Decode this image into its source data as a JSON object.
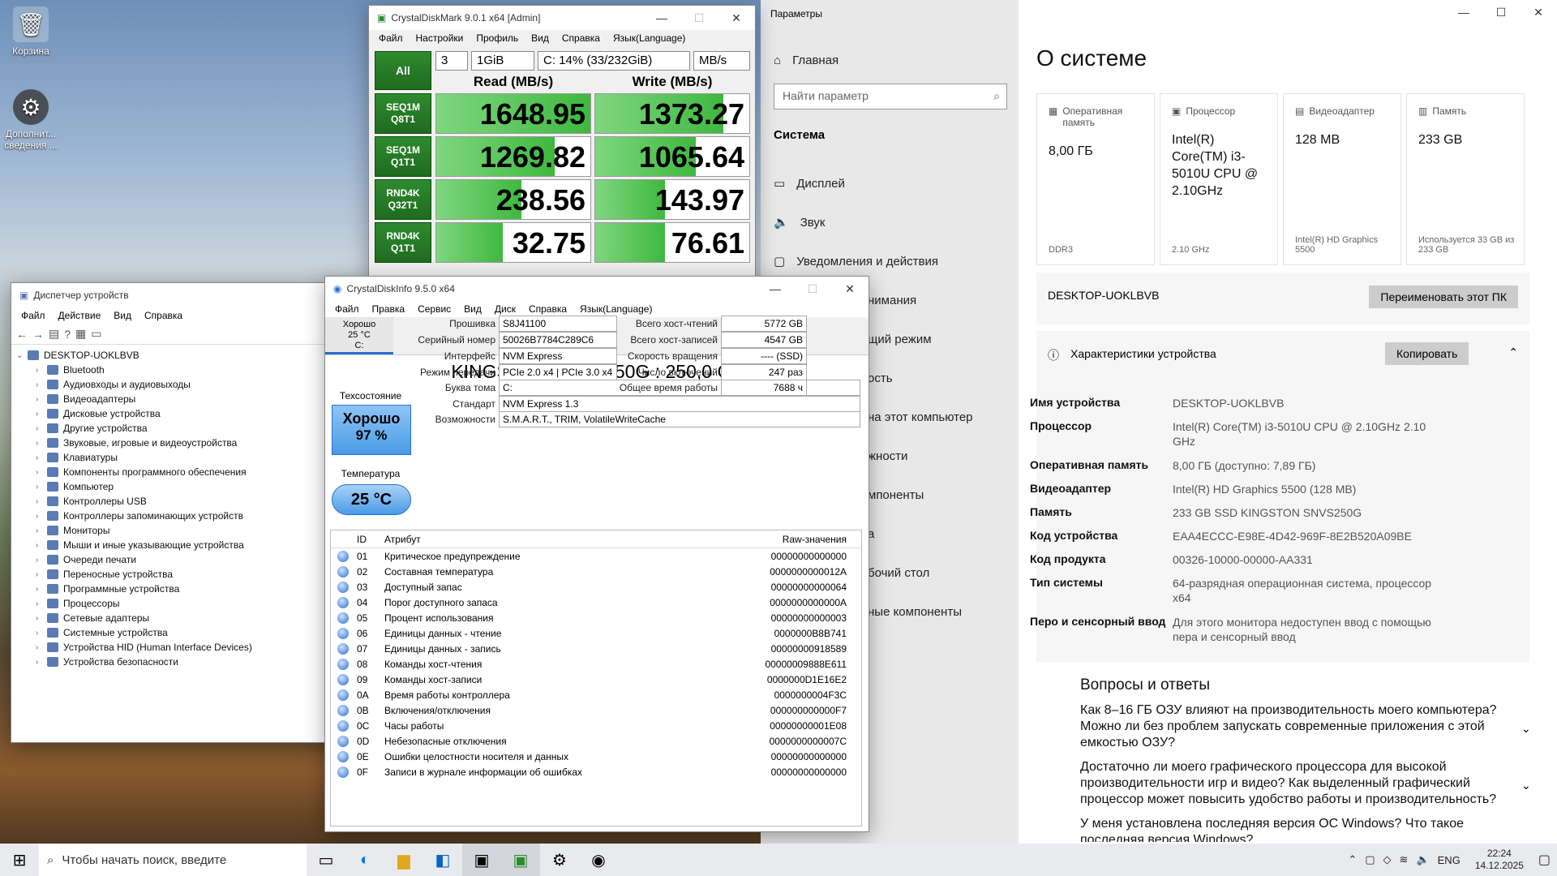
{
  "desktop": {
    "icons": [
      {
        "label": "Корзина"
      },
      {
        "label": "Дополнит... сведения ..."
      }
    ]
  },
  "settings": {
    "window_title": "Параметры",
    "home": "Главная",
    "search_placeholder": "Найти параметр",
    "section": "Система",
    "nav": [
      {
        "label": "Дисплей"
      },
      {
        "label": "Звук"
      },
      {
        "label": "Уведомления и действия"
      },
      {
        "label": "нимания"
      },
      {
        "label": "щий режим"
      },
      {
        "label": "ость"
      },
      {
        "label": "на этот компьютер"
      },
      {
        "label": "жности"
      },
      {
        "label": "мпоненты"
      },
      {
        "label": "а"
      },
      {
        "label": "бочий стол"
      },
      {
        "label": "ные компоненты"
      }
    ],
    "page_title": "О системе",
    "cards": [
      {
        "caption": "Оперативная память",
        "value": "8,00 ГБ",
        "sub": "DDR3"
      },
      {
        "caption": "Процессор",
        "value": "Intel(R) Core(TM) i3-5010U CPU @ 2.10GHz",
        "sub": "2.10 GHz"
      },
      {
        "caption": "Видеоадаптер",
        "value": "128 MB",
        "sub": "Intel(R) HD Graphics 5500"
      },
      {
        "caption": "Память",
        "value": "233 GB",
        "sub": "Используется 33 GB из 233 GB"
      }
    ],
    "pc_name": "DESKTOP-UOKLBVB",
    "rename_button": "Переименовать этот ПК",
    "device_specs_title": "Характеристики устройства",
    "copy_button": "Копировать",
    "specs": [
      {
        "k": "Имя устройства",
        "v": "DESKTOP-UOKLBVB"
      },
      {
        "k": "Процессор",
        "v": "Intel(R) Core(TM) i3-5010U CPU @ 2.10GHz   2.10 GHz"
      },
      {
        "k": "Оперативная память",
        "v": "8,00 ГБ (доступно: 7,89 ГБ)"
      },
      {
        "k": "Видеоадаптер",
        "v": "Intel(R) HD Graphics 5500 (128 MB)"
      },
      {
        "k": "Память",
        "v": "233 GB SSD KINGSTON SNVS250G"
      },
      {
        "k": "Код устройства",
        "v": "EAA4ECCC-E98E-4D42-969F-8E2B520A09BE"
      },
      {
        "k": "Код продукта",
        "v": "00326-10000-00000-AA331"
      },
      {
        "k": "Тип системы",
        "v": "64-разрядная операционная система, процессор x64"
      },
      {
        "k": "Перо и сенсорный ввод",
        "v": "Для этого монитора недоступен ввод с помощью пера и сенсорный ввод"
      }
    ],
    "qa_title": "Вопросы и ответы",
    "qa": [
      {
        "q": "Как 8–16 ГБ ОЗУ влияют на производительность моего компьютера? Можно ли без проблем запускать современные приложения с этой емкостью ОЗУ?"
      },
      {
        "q": "Достаточно ли моего графического процессора для высокой производительности игр и видео? Как выделенный графический процессор может повысить удобство работы и производительность?"
      },
      {
        "q": "У меня установлена последняя версия ОС Windows? Что такое последняя версия Windows?"
      }
    ]
  },
  "cdm": {
    "title": "CrystalDiskMark 9.0.1 x64 [Admin]",
    "menu": [
      "Файл",
      "Настройки",
      "Профиль",
      "Вид",
      "Справка",
      "Язык(Language)"
    ],
    "all_button": "All",
    "count": "3",
    "size": "1GiB",
    "drive": "C: 14% (33/232GiB)",
    "unit": "MB/s",
    "read_header": "Read (MB/s)",
    "write_header": "Write (MB/s)",
    "rows": [
      {
        "l1": "SEQ1M",
        "l2": "Q8T1",
        "read": "1648.95",
        "write": "1373.27",
        "rfill": 1.0,
        "wfill": 0.83
      },
      {
        "l1": "SEQ1M",
        "l2": "Q1T1",
        "read": "1269.82",
        "write": "1065.64",
        "rfill": 0.77,
        "wfill": 0.65
      },
      {
        "l1": "RND4K",
        "l2": "Q32T1",
        "read": "238.56",
        "write": "143.97",
        "rfill": 0.55,
        "wfill": 0.45
      },
      {
        "l1": "RND4K",
        "l2": "Q1T1",
        "read": "32.75",
        "write": "76.61",
        "rfill": 0.43,
        "wfill": 0.45
      }
    ]
  },
  "devmgr": {
    "title": "Диспетчер устройств",
    "menu": [
      "Файл",
      "Действие",
      "Вид",
      "Справка"
    ],
    "root": "DESKTOP-UOKLBVB",
    "items": [
      "Bluetooth",
      "Аудиовходы и аудиовыходы",
      "Видеоадаптеры",
      "Дисковые устройства",
      "Другие устройства",
      "Звуковые, игровые и видеоустройства",
      "Клавиатуры",
      "Компоненты программного обеспечения",
      "Компьютер",
      "Контроллеры USB",
      "Контроллеры запоминающих устройств",
      "Мониторы",
      "Мыши и иные указывающие устройства",
      "Очереди печати",
      "Переносные устройства",
      "Программные устройства",
      "Процессоры",
      "Сетевые адаптеры",
      "Системные устройства",
      "Устройства HID (Human Interface Devices)",
      "Устройства безопасности"
    ]
  },
  "cdi": {
    "title": "CrystalDiskInfo 9.5.0 x64",
    "menu": [
      "Файл",
      "Правка",
      "Сервис",
      "Вид",
      "Диск",
      "Справка",
      "Язык(Language)"
    ],
    "tab_status": "Хорошо",
    "tab_temp": "25 °C",
    "tab_drive": "C:",
    "model": "KINGSTON SNVS250G : 250,0 GB",
    "health_label": "Техсостояние",
    "health_text": "Хорошо",
    "health_pct": "97 %",
    "temp_label": "Температура",
    "temp_value": "25 °C",
    "left_fields": [
      {
        "k": "Прошивка",
        "v": "S8J41100"
      },
      {
        "k": "Серийный номер",
        "v": "50026B7784C289C6"
      },
      {
        "k": "Интерфейс",
        "v": "NVM Express"
      },
      {
        "k": "Режим передачи",
        "v": "PCIe 2.0 x4 | PCIe 3.0 x4"
      },
      {
        "k": "Буква тома",
        "v": "C:"
      },
      {
        "k": "Стандарт",
        "v": "NVM Express 1.3"
      },
      {
        "k": "Возможности",
        "v": "S.M.A.R.T., TRIM, VolatileWriteCache"
      }
    ],
    "right_fields": [
      {
        "k": "Всего хост-чтений",
        "v": "5772 GB"
      },
      {
        "k": "Всего хост-записей",
        "v": "4547 GB"
      },
      {
        "k": "Скорость вращения",
        "v": "---- (SSD)"
      },
      {
        "k": "Число включений",
        "v": "247 раз"
      },
      {
        "k": "Общее время работы",
        "v": "7688 ч"
      }
    ],
    "table_headers": {
      "id": "ID",
      "name": "Атрибут",
      "raw": "Raw-значения"
    },
    "attributes": [
      {
        "id": "01",
        "name": "Критическое предупреждение",
        "raw": "00000000000000"
      },
      {
        "id": "02",
        "name": "Составная температура",
        "raw": "0000000000012A"
      },
      {
        "id": "03",
        "name": "Доступный запас",
        "raw": "00000000000064"
      },
      {
        "id": "04",
        "name": "Порог доступного запаса",
        "raw": "0000000000000A"
      },
      {
        "id": "05",
        "name": "Процент использования",
        "raw": "00000000000003"
      },
      {
        "id": "06",
        "name": "Единицы данных - чтение",
        "raw": "0000000B8B741"
      },
      {
        "id": "07",
        "name": "Единицы данных - запись",
        "raw": "00000000918589"
      },
      {
        "id": "08",
        "name": "Команды хост-чтения",
        "raw": "00000009888E611"
      },
      {
        "id": "09",
        "name": "Команды хост-записи",
        "raw": "0000000D1E16E2"
      },
      {
        "id": "0A",
        "name": "Время работы контроллера",
        "raw": "0000000004F3C"
      },
      {
        "id": "0B",
        "name": "Включения/отключения",
        "raw": "000000000000F7"
      },
      {
        "id": "0C",
        "name": "Часы работы",
        "raw": "00000000001E08"
      },
      {
        "id": "0D",
        "name": "Небезопасные отключения",
        "raw": "0000000000007C"
      },
      {
        "id": "0E",
        "name": "Ошибки целостности носителя и данных",
        "raw": "00000000000000"
      },
      {
        "id": "0F",
        "name": "Записи в журнале информации об ошибках",
        "raw": "00000000000000"
      }
    ]
  },
  "taskbar": {
    "search_placeholder": "Чтобы начать поиск, введите",
    "lang": "ENG",
    "time": "22:24",
    "date": "14.12.2025"
  }
}
